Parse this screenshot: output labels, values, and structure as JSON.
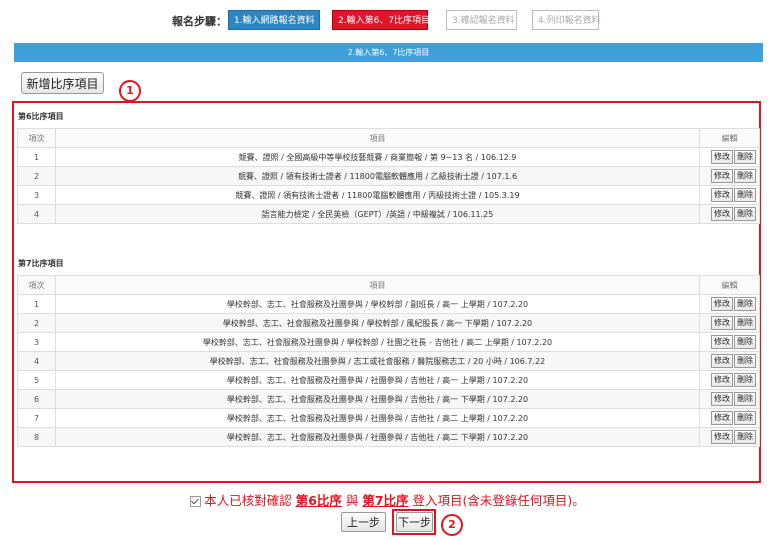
{
  "steps": {
    "label": "報名步驟：",
    "items": [
      {
        "label": "1.輸入網路報名資料"
      },
      {
        "label": "2.輸入第6、7比序項目"
      },
      {
        "label": "3.確認報名資料"
      },
      {
        "label": "4.列印報名資料"
      }
    ]
  },
  "banner": "2.輸入第6、7比序項目",
  "add_button": "新增比序項目",
  "annotations": {
    "one": "1",
    "two": "2"
  },
  "columns": {
    "index": "項次",
    "item": "項目",
    "edit": "編輯"
  },
  "actions": {
    "edit": "修改",
    "delete": "刪除"
  },
  "section6": {
    "title": "第6比序項目",
    "rows": [
      {
        "no": "1",
        "item": "競賽、證照 / 全國高級中等學校技藝競賽 / 商業簡報 / 第 9~13 名 / 106.12.9"
      },
      {
        "no": "2",
        "item": "競賽、證照 / 領有技術士證者 / 11800電腦軟體應用 / 乙級技術士證 / 107.1.6"
      },
      {
        "no": "3",
        "item": "競賽、證照 / 領有技術士證者 / 11800電腦軟體應用 / 丙級技術士證 / 105.3.19"
      },
      {
        "no": "4",
        "item": "語言能力檢定 / 全民英檢（GEPT）/英語 / 中級複試 / 106.11.25"
      }
    ]
  },
  "section7": {
    "title": "第7比序項目",
    "rows": [
      {
        "no": "1",
        "item": "學校幹部、志工、社會服務及社團參與 / 學校幹部 / 副班長 / 高一 上學期 / 107.2.20"
      },
      {
        "no": "2",
        "item": "學校幹部、志工、社會服務及社團參與 / 學校幹部 / 風紀股長 / 高一 下學期 / 107.2.20"
      },
      {
        "no": "3",
        "item": "學校幹部、志工、社會服務及社團參與 / 學校幹部 / 社團之社長 - 吉他社 / 高二 上學期 / 107.2.20"
      },
      {
        "no": "4",
        "item": "學校幹部、志工、社會服務及社團參與 / 志工或社會服務 / 醫院服務志工 / 20 小時 / 106.7.22"
      },
      {
        "no": "5",
        "item": "學校幹部、志工、社會服務及社團參與 / 社團參與 / 吉他社 / 高一 上學期 / 107.2.20"
      },
      {
        "no": "6",
        "item": "學校幹部、志工、社會服務及社團參與 / 社團參與 / 吉他社 / 高一 下學期 / 107.2.20"
      },
      {
        "no": "7",
        "item": "學校幹部、志工、社會服務及社團參與 / 社團參與 / 吉他社 / 高二 上學期 / 107.2.20"
      },
      {
        "no": "8",
        "item": "學校幹部、志工、社會服務及社團參與 / 社團參與 / 吉他社 / 高二 下學期 / 107.2.20"
      }
    ]
  },
  "confirm": {
    "prefix": "本人已核對確認 ",
    "s6": "第6比序",
    "mid": " 與 ",
    "s7": "第7比序",
    "suffix": " 登入項目(含未登錄任何項目)。"
  },
  "nav": {
    "prev": "上一步",
    "next": "下一步"
  }
}
